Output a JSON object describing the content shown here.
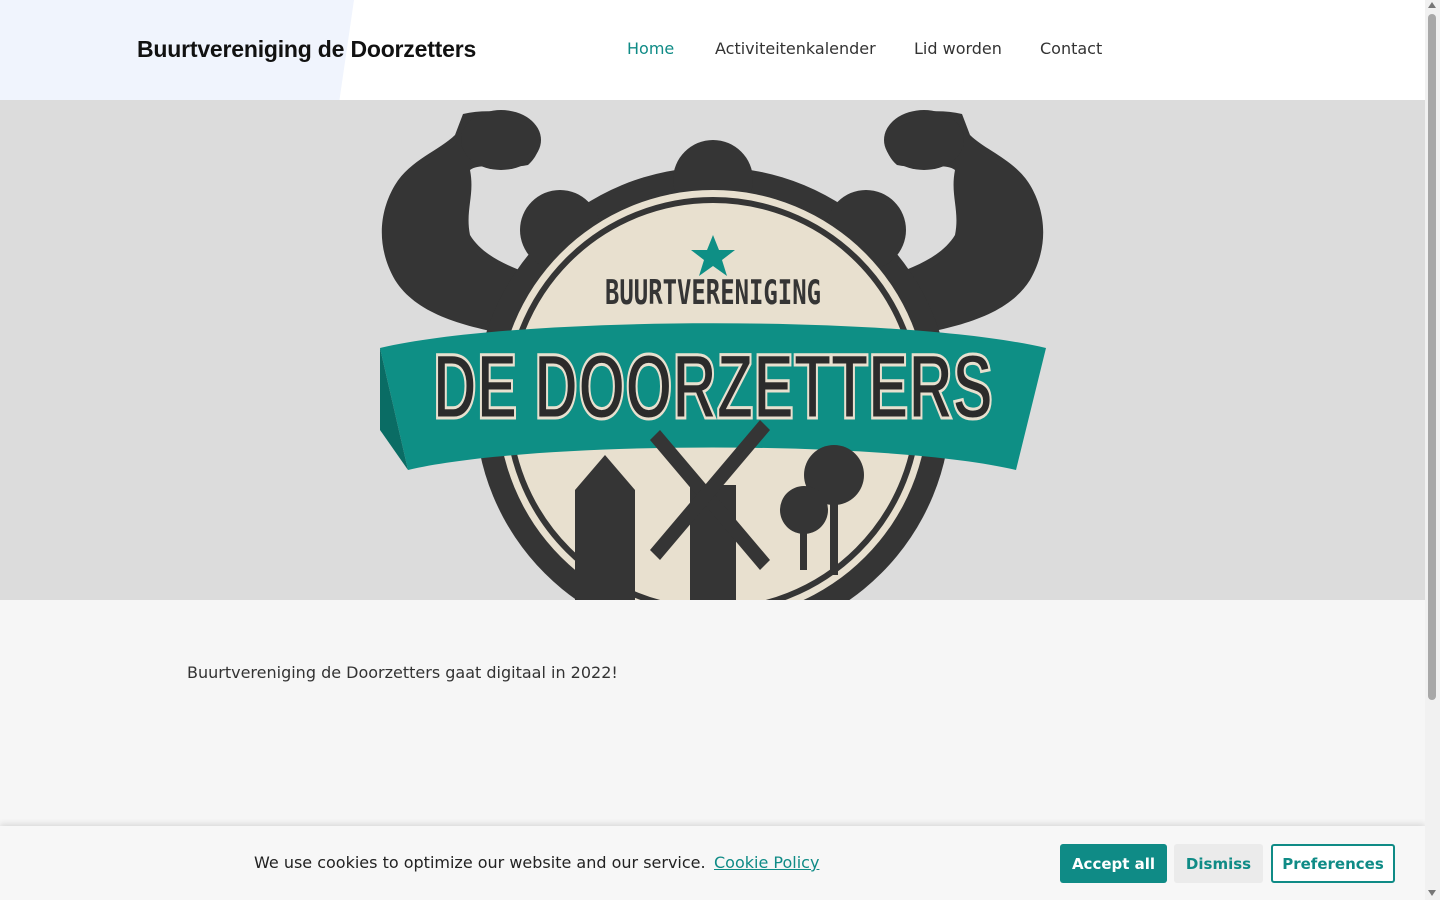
{
  "header": {
    "brand": "Buurtvereniging de Doorzetters",
    "nav": [
      {
        "label": "Home",
        "active": true
      },
      {
        "label": "Activiteitenkalender",
        "active": false
      },
      {
        "label": "Lid worden",
        "active": false
      },
      {
        "label": "Contact",
        "active": false
      }
    ]
  },
  "hero": {
    "logo_text_top": "BUURTVERENIGING",
    "logo_text_banner": "DE DOORZETTERS",
    "colors": {
      "dark": "#353535",
      "teal": "#0e8f85",
      "cream": "#e8e0cf",
      "background": "#dcdcdc"
    }
  },
  "content": {
    "intro": "Buurtvereniging de Doorzetters gaat digitaal in 2022!"
  },
  "cookie": {
    "message": "We use cookies to optimize our website and our service.",
    "policy_link": "Cookie Policy",
    "accept": "Accept all",
    "dismiss": "Dismiss",
    "preferences": "Preferences"
  },
  "colors": {
    "accent": "#0f8b86"
  }
}
